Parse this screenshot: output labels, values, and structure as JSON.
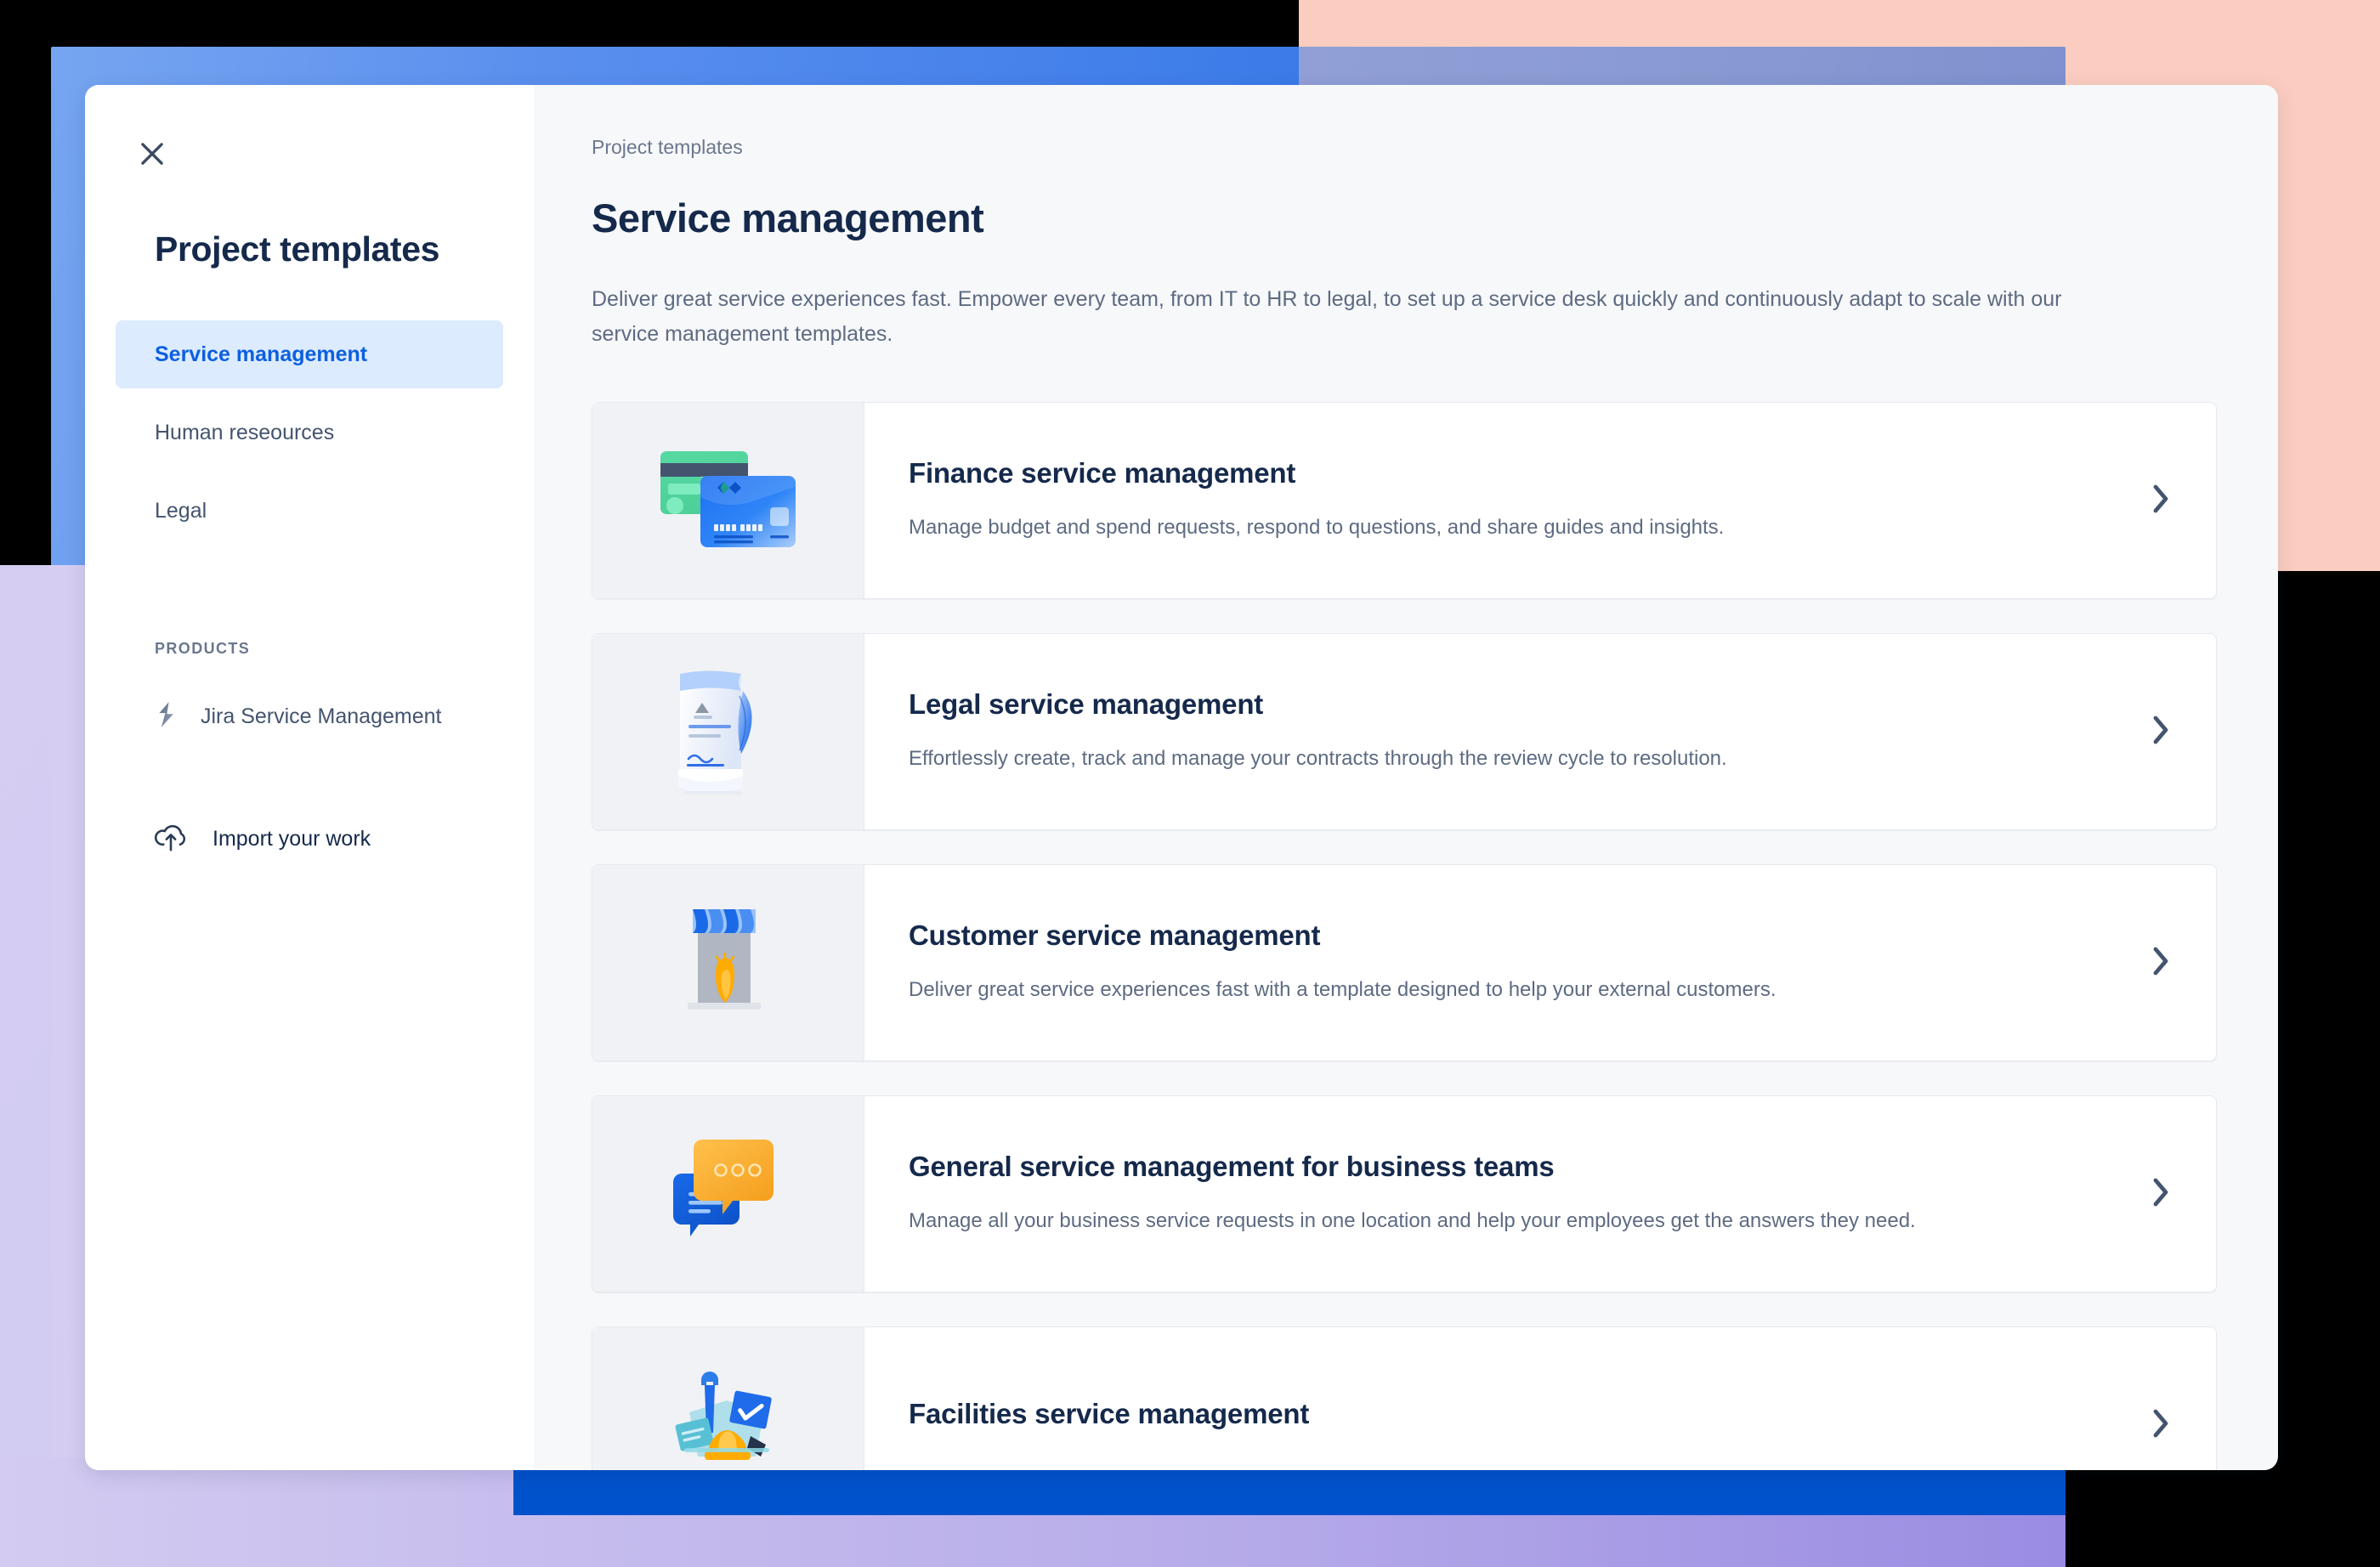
{
  "window": {
    "close_icon": "close-x-icon"
  },
  "sidebar": {
    "title": "Project templates",
    "nav": [
      {
        "label": "Service management",
        "active": true
      },
      {
        "label": "Human reseources",
        "active": false
      },
      {
        "label": "Legal",
        "active": false
      }
    ],
    "section_label": "PRODUCTS",
    "product": {
      "label": "Jira Service Management",
      "icon": "jira-service-management-logo-icon"
    },
    "import": {
      "label": "Import your work",
      "icon": "cloud-upload-icon"
    }
  },
  "main": {
    "breadcrumb": "Project templates",
    "title": "Service management",
    "description": "Deliver great service experiences fast. Empower every team, from IT to HR to legal, to set up a service desk quickly and continuously adapt to scale with our service management templates.",
    "cards": [
      {
        "title": "Finance service management",
        "description": "Manage budget and spend requests, respond to questions, and share guides and insights.",
        "thumb_icon": "credit-cards-illustration",
        "arrow_icon": "chevron-right-icon"
      },
      {
        "title": "Legal service management",
        "description": "Effortlessly create, track and manage your contracts through the review cycle to resolution.",
        "thumb_icon": "scroll-quill-illustration",
        "arrow_icon": "chevron-right-icon"
      },
      {
        "title": "Customer service management",
        "description": "Deliver great service experiences fast with a template designed to help your external customers.",
        "thumb_icon": "storefront-illustration",
        "arrow_icon": "chevron-right-icon"
      },
      {
        "title": "General service management for business teams",
        "description": "Manage all your business service requests in one location and help your employees get the answers they need.",
        "thumb_icon": "chat-bubbles-illustration",
        "arrow_icon": "chevron-right-icon"
      },
      {
        "title": "Facilities service management",
        "description": "",
        "thumb_icon": "tools-hardhat-illustration",
        "arrow_icon": "chevron-right-icon"
      }
    ]
  },
  "colors": {
    "accent_blue": "#0c5fe0",
    "nav_active_bg": "#dcebfe",
    "text_dark": "#15294b",
    "text_muted": "#5d6b82",
    "panel_bg": "#f7f8fa",
    "card_bg": "#ffffff",
    "thumb_bg": "#f1f2f5",
    "backdrop_salmon": "#fbcdc0",
    "backdrop_blue": "#0052cc",
    "backdrop_lilac": "#d6cdf2"
  }
}
